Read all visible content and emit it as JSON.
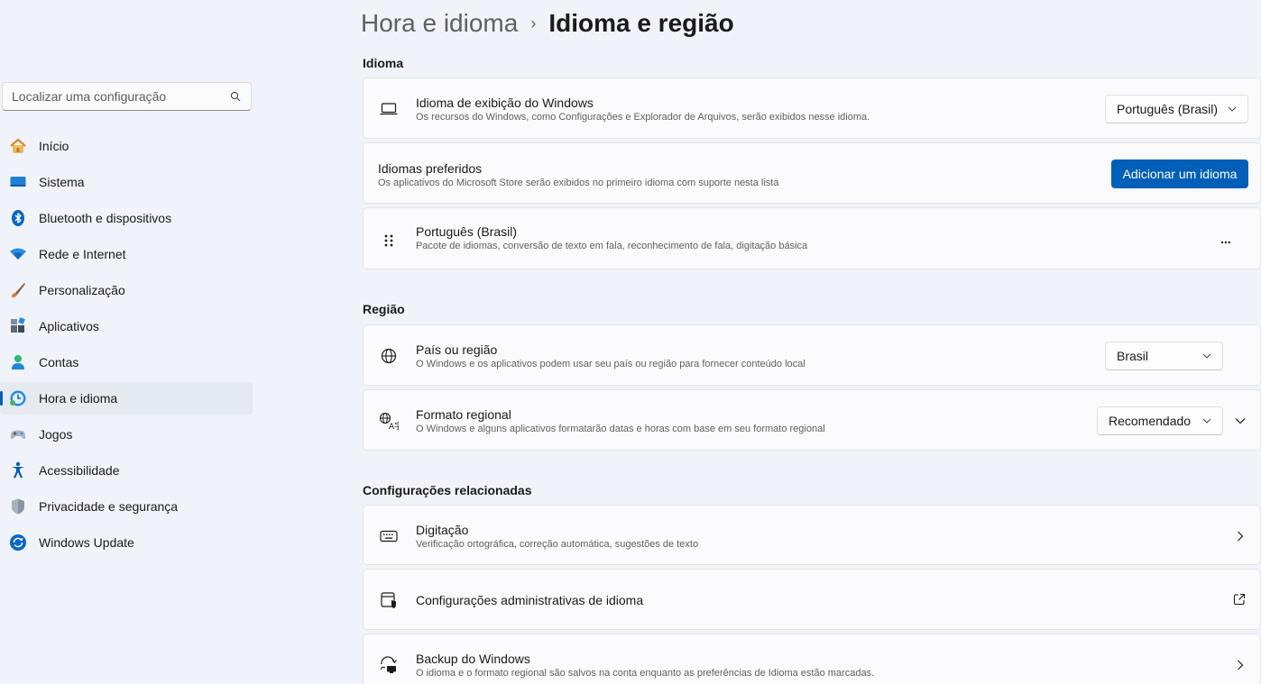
{
  "breadcrumb": {
    "parent": "Hora e idioma",
    "separator": "›",
    "current": "Idioma e região"
  },
  "search": {
    "placeholder": "Localizar uma configuração",
    "icon": "search-icon"
  },
  "sidebar": {
    "items": [
      {
        "label": "Início",
        "icon": "home-icon",
        "active": false
      },
      {
        "label": "Sistema",
        "icon": "system-icon",
        "active": false
      },
      {
        "label": "Bluetooth e dispositivos",
        "icon": "bluetooth-icon",
        "active": false
      },
      {
        "label": "Rede e Internet",
        "icon": "wifi-icon",
        "active": false
      },
      {
        "label": "Personalização",
        "icon": "brush-icon",
        "active": false
      },
      {
        "label": "Aplicativos",
        "icon": "apps-icon",
        "active": false
      },
      {
        "label": "Contas",
        "icon": "account-icon",
        "active": false
      },
      {
        "label": "Hora e idioma",
        "icon": "time-language-icon",
        "active": true
      },
      {
        "label": "Jogos",
        "icon": "gamepad-icon",
        "active": false
      },
      {
        "label": "Acessibilidade",
        "icon": "accessibility-icon",
        "active": false
      },
      {
        "label": "Privacidade e segurança",
        "icon": "shield-icon",
        "active": false
      },
      {
        "label": "Windows Update",
        "icon": "update-icon",
        "active": false
      }
    ]
  },
  "sections": {
    "idioma": "Idioma",
    "regiao": "Região",
    "relacionadas": "Configurações relacionadas"
  },
  "display_language": {
    "title": "Idioma de exibição do Windows",
    "subtitle": "Os recursos do Windows, como Configurações e Explorador de Arquivos, serão exibidos nesse idioma.",
    "value": "Português (Brasil)",
    "icon": "monitor-icon"
  },
  "preferred_languages": {
    "title": "Idiomas preferidos",
    "subtitle": "Os aplicativos do Microsoft Store serão exibidos no primeiro idioma com suporte nesta lista",
    "button": "Adicionar um idioma"
  },
  "language_entry": {
    "title": "Português (Brasil)",
    "subtitle": "Pacote de idiomas, conversão de texto em fala, reconhecimento de fala, digitação básica",
    "more": "...",
    "icon": "drag-handle-icon"
  },
  "country": {
    "title": "País ou região",
    "subtitle": "O Windows e os aplicativos podem usar seu país ou região para fornecer conteúdo local",
    "value": "Brasil",
    "icon": "globe-icon"
  },
  "regional_format": {
    "title": "Formato regional",
    "subtitle": "O Windows e alguns aplicativos formatarão datas e horas com base em seu formato regional",
    "value": "Recomendado",
    "icon": "regional-format-icon"
  },
  "typing": {
    "title": "Digitação",
    "subtitle": "Verificação ortográfica, correção automática, sugestões de texto",
    "icon": "keyboard-icon"
  },
  "admin_language": {
    "title": "Configurações administrativas de idioma",
    "icon": "admin-language-icon"
  },
  "backup": {
    "title": "Backup do Windows",
    "subtitle": "O idioma e o formato regional são salvos na conta enquanto as preferências de Idioma estão marcadas.",
    "icon": "backup-icon"
  },
  "colors": {
    "accent": "#005fb8",
    "background": "#f0f3f9",
    "card": "#fbfbfd"
  }
}
